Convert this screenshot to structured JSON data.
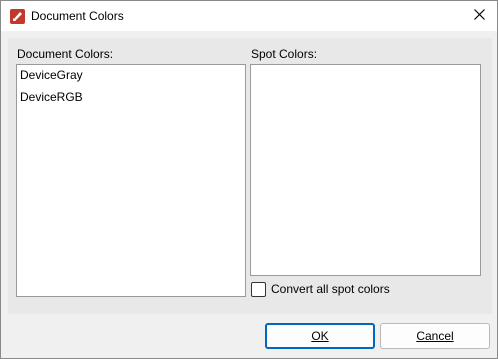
{
  "window": {
    "title": "Document Colors"
  },
  "document_colors": {
    "label": "Document Colors:",
    "items": [
      "DeviceGray",
      "DeviceRGB"
    ]
  },
  "spot_colors": {
    "label": "Spot Colors:",
    "items": []
  },
  "convert_checkbox": {
    "label": "Convert all spot colors",
    "checked": false
  },
  "buttons": {
    "ok": "OK",
    "cancel": "Cancel"
  },
  "colors": {
    "app_icon": "#c0392b",
    "default_button_border": "#0067c0"
  }
}
